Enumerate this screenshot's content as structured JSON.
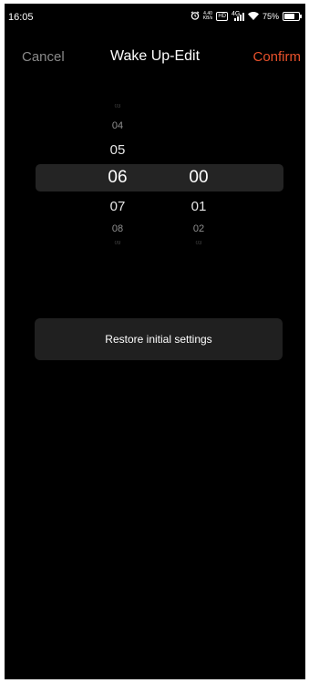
{
  "status_bar": {
    "time": "16:05",
    "net_speed_value": "4.40",
    "net_speed_unit": "KB/s",
    "hd_badge": "HD",
    "signal_label": "4G",
    "battery_text": "75%",
    "battery_level": 0.75,
    "icons": [
      "alarm-icon",
      "hd-icon",
      "signal-icon",
      "wifi-icon",
      "battery-icon"
    ]
  },
  "header": {
    "cancel_label": "Cancel",
    "title": "Wake Up-Edit",
    "confirm_label": "Confirm"
  },
  "picker": {
    "hours": [
      "03",
      "04",
      "05",
      "06",
      "07",
      "08",
      "09"
    ],
    "minutes": [
      "",
      "",
      "",
      "00",
      "01",
      "02",
      "03"
    ],
    "selected_index": 3
  },
  "restore_label": "Restore initial settings",
  "colors": {
    "background": "#000000",
    "accent": "#e8512b",
    "secondary_text": "#8a8a8a",
    "highlight_band": "#242424",
    "button_bg": "#202020"
  }
}
